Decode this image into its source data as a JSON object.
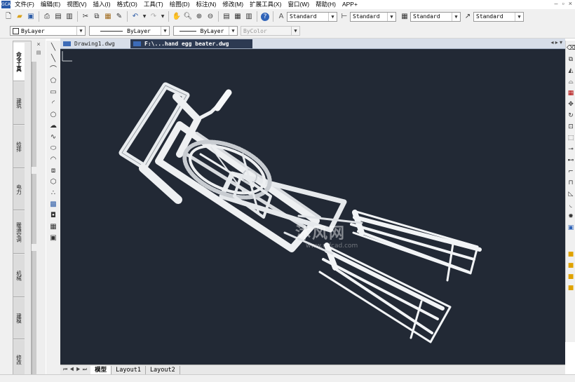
{
  "app": {
    "icon_text": "GCAD",
    "menu": [
      "文件(F)",
      "编辑(E)",
      "视图(V)",
      "插入(I)",
      "格式(O)",
      "工具(T)",
      "绘图(D)",
      "标注(N)",
      "修改(M)",
      "扩展工具(X)",
      "窗口(W)",
      "帮助(H)",
      "APP+"
    ],
    "window_controls": [
      "–",
      "▫",
      "×"
    ]
  },
  "toolbar1": {
    "text_style": "Standard",
    "dim_style": "Standard",
    "table_style": "Standard",
    "mleader_style": "Standard"
  },
  "toolbar2": {
    "layer": "ByLayer",
    "linetype": "ByLayer",
    "lineweight": "ByLayer",
    "plotstyle": "ByColor"
  },
  "left_palette": {
    "tabs": [
      "命令工具",
      "建筑",
      "给排",
      "电力",
      "暖通空调",
      "机械",
      "建模",
      "修改"
    ]
  },
  "document_tabs": [
    {
      "label": "Drawing1.dwg",
      "active": false
    },
    {
      "label": "F:\\...hand egg beater.dwg",
      "active": true
    }
  ],
  "layout_tabs": [
    {
      "label": "模型",
      "active": true
    },
    {
      "label": "Layout1",
      "active": false
    },
    {
      "label": "Layout2",
      "active": false
    }
  ],
  "watermark": {
    "text": "沐风网",
    "sub": "www.mfcad.com"
  },
  "colors": {
    "canvas": "#222935",
    "active_tab": "#2d3a52",
    "icon_blue": "#3c6bb8"
  }
}
